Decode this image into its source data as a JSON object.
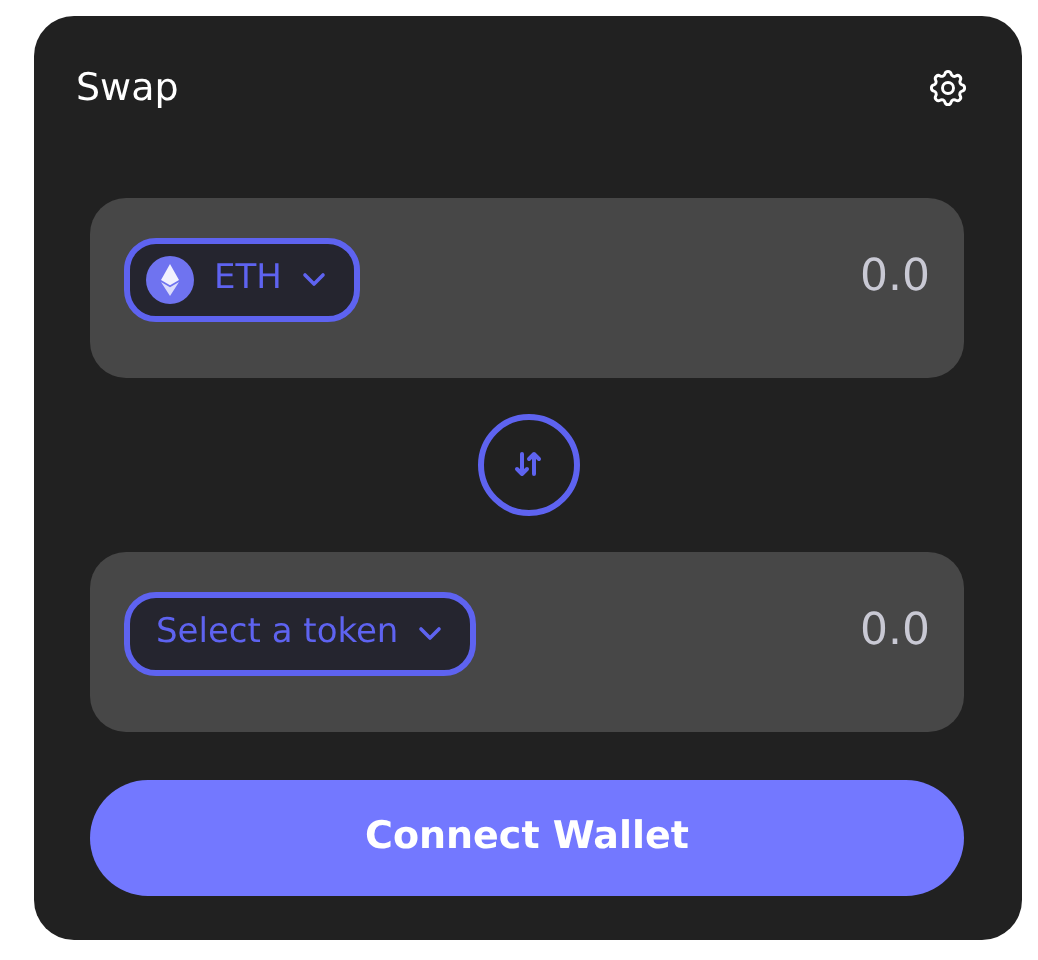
{
  "title": "Swap",
  "panels": [
    {
      "token": {
        "kind": "token",
        "label": "ETH"
      },
      "amount": {
        "placeholder": "0.0"
      }
    },
    {
      "token": {
        "kind": "select",
        "label": "Select a token"
      },
      "amount": {
        "placeholder": "0.0"
      }
    }
  ],
  "connect_button": "Connect Wallet"
}
